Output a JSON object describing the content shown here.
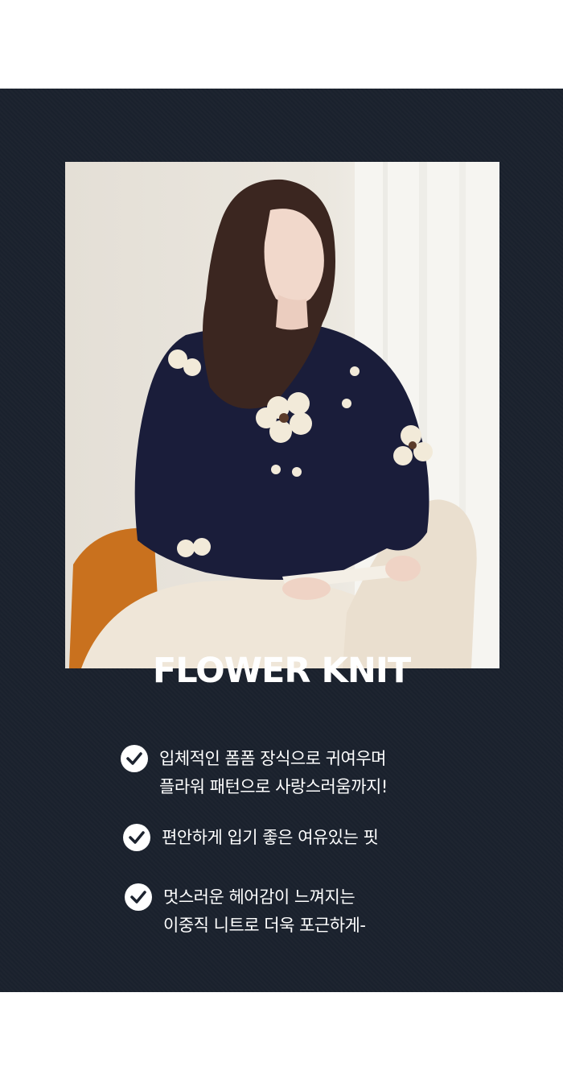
{
  "title": "FLOWER KNIT",
  "colors": {
    "page_background": "#ffffff",
    "panel_background": "#1b222e",
    "text": "#ffffff",
    "check_circle": "#ffffff",
    "check_mark": "#1b222e"
  },
  "photo": {
    "icon": "model-photo"
  },
  "features": [
    {
      "icon": "check-circle-icon",
      "lines": [
        "입체적인 폼폼 장식으로 귀여우며",
        "플라워 패턴으로 사랑스러움까지!"
      ]
    },
    {
      "icon": "check-circle-icon",
      "lines": [
        "편안하게 입기 좋은 여유있는 핏"
      ]
    },
    {
      "icon": "check-circle-icon",
      "lines": [
        "멋스러운 헤어감이 느껴지는",
        "이중직 니트로 더욱 포근하게-"
      ]
    }
  ]
}
